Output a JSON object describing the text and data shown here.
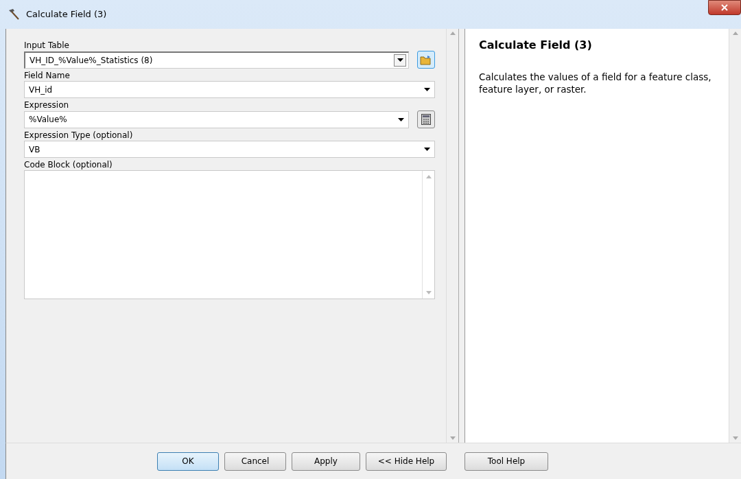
{
  "window": {
    "title": "Calculate Field (3)"
  },
  "fields": [
    {
      "label": "Input Table",
      "value": "VH_ID_%Value%_Statistics (8)",
      "kind": "combo",
      "button": {
        "kind": "browse"
      }
    },
    {
      "label": "Field Name",
      "value": "VH_id",
      "kind": "dropdown"
    },
    {
      "label": "Expression",
      "value": "%Value%",
      "kind": "dropdown",
      "button": {
        "kind": "calculator"
      }
    },
    {
      "label": "Expression Type (optional)",
      "value": "VB",
      "kind": "dropdown"
    },
    {
      "label": "Code Block (optional)",
      "kind": "textarea"
    }
  ],
  "help": {
    "title": "Calculate Field (3)",
    "text": "Calculates the values of a field for a feature class, feature layer, or raster."
  },
  "buttons": [
    {
      "label": "OK",
      "default": true
    },
    {
      "label": "Cancel",
      "default": false
    },
    {
      "label": "Apply",
      "default": false
    },
    {
      "label": "<< Hide Help",
      "default": false
    },
    {
      "label": "Tool Help",
      "default": false
    }
  ]
}
